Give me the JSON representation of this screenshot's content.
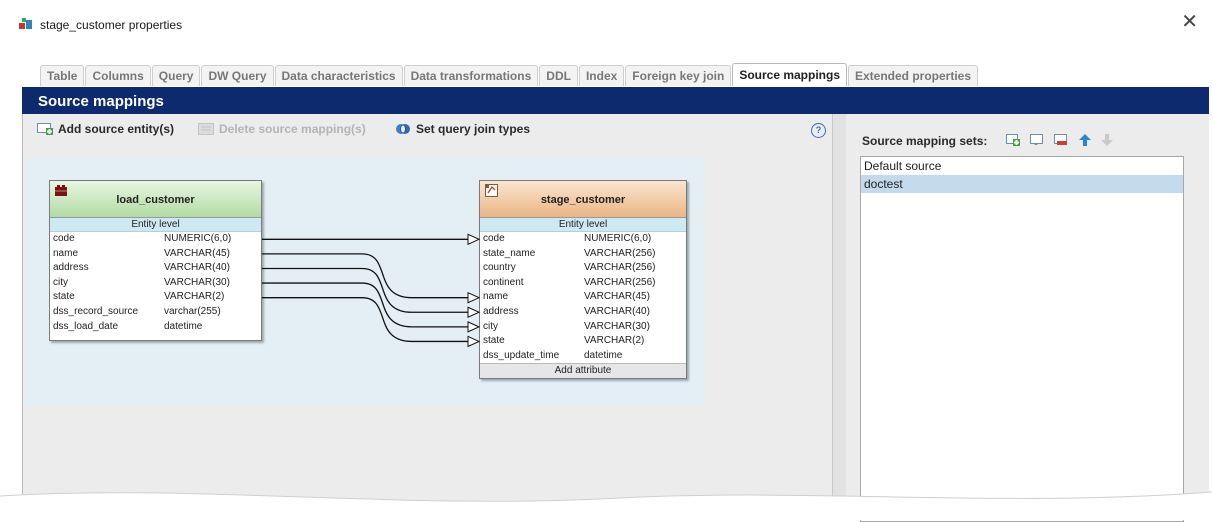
{
  "window": {
    "title": "stage_customer properties",
    "close_glyph": "✕"
  },
  "tabs": [
    {
      "label": "Table",
      "active": false
    },
    {
      "label": "Columns",
      "active": false
    },
    {
      "label": "Query",
      "active": false
    },
    {
      "label": "DW Query",
      "active": false
    },
    {
      "label": "Data characteristics",
      "active": false
    },
    {
      "label": "Data transformations",
      "active": false
    },
    {
      "label": "DDL",
      "active": false
    },
    {
      "label": "Index",
      "active": false
    },
    {
      "label": "Foreign key join",
      "active": false
    },
    {
      "label": "Source mappings",
      "active": true
    },
    {
      "label": "Extended properties",
      "active": false
    }
  ],
  "header": {
    "title": "Source mappings",
    "color": "#0d2a6e"
  },
  "toolbar": {
    "add_source": "Add source entity(s)",
    "delete_mapping": "Delete source mapping(s)",
    "set_join": "Set query join types",
    "help_glyph": "?"
  },
  "source_entity": {
    "name": "load_customer",
    "level": "Entity level",
    "header_color": "#b2dba4",
    "attributes": [
      {
        "name": "code",
        "type": "NUMERIC(6,0)"
      },
      {
        "name": "name",
        "type": "VARCHAR(45)"
      },
      {
        "name": "address",
        "type": "VARCHAR(40)"
      },
      {
        "name": "city",
        "type": "VARCHAR(30)"
      },
      {
        "name": "state",
        "type": "VARCHAR(2)"
      },
      {
        "name": "dss_record_source",
        "type": "varchar(255)"
      },
      {
        "name": "dss_load_date",
        "type": "datetime"
      }
    ]
  },
  "target_entity": {
    "name": "stage_customer",
    "level": "Entity level",
    "header_color": "#ebb585",
    "add_attribute": "Add attribute",
    "attributes": [
      {
        "name": "code",
        "type": "NUMERIC(6,0)"
      },
      {
        "name": "state_name",
        "type": "VARCHAR(256)"
      },
      {
        "name": "country",
        "type": "VARCHAR(256)"
      },
      {
        "name": "continent",
        "type": "VARCHAR(256)"
      },
      {
        "name": "name",
        "type": "VARCHAR(45)"
      },
      {
        "name": "address",
        "type": "VARCHAR(40)"
      },
      {
        "name": "city",
        "type": "VARCHAR(30)"
      },
      {
        "name": "state",
        "type": "VARCHAR(2)"
      },
      {
        "name": "dss_update_time",
        "type": "datetime"
      }
    ]
  },
  "mappings": [
    {
      "from": 0,
      "to": 0
    },
    {
      "from": 1,
      "to": 4
    },
    {
      "from": 2,
      "to": 5
    },
    {
      "from": 3,
      "to": 6
    },
    {
      "from": 4,
      "to": 7
    }
  ],
  "source_mapping_sets": {
    "label": "Source mapping sets:",
    "items": [
      {
        "label": "Default source",
        "selected": false
      },
      {
        "label": "doctest",
        "selected": true
      }
    ]
  }
}
